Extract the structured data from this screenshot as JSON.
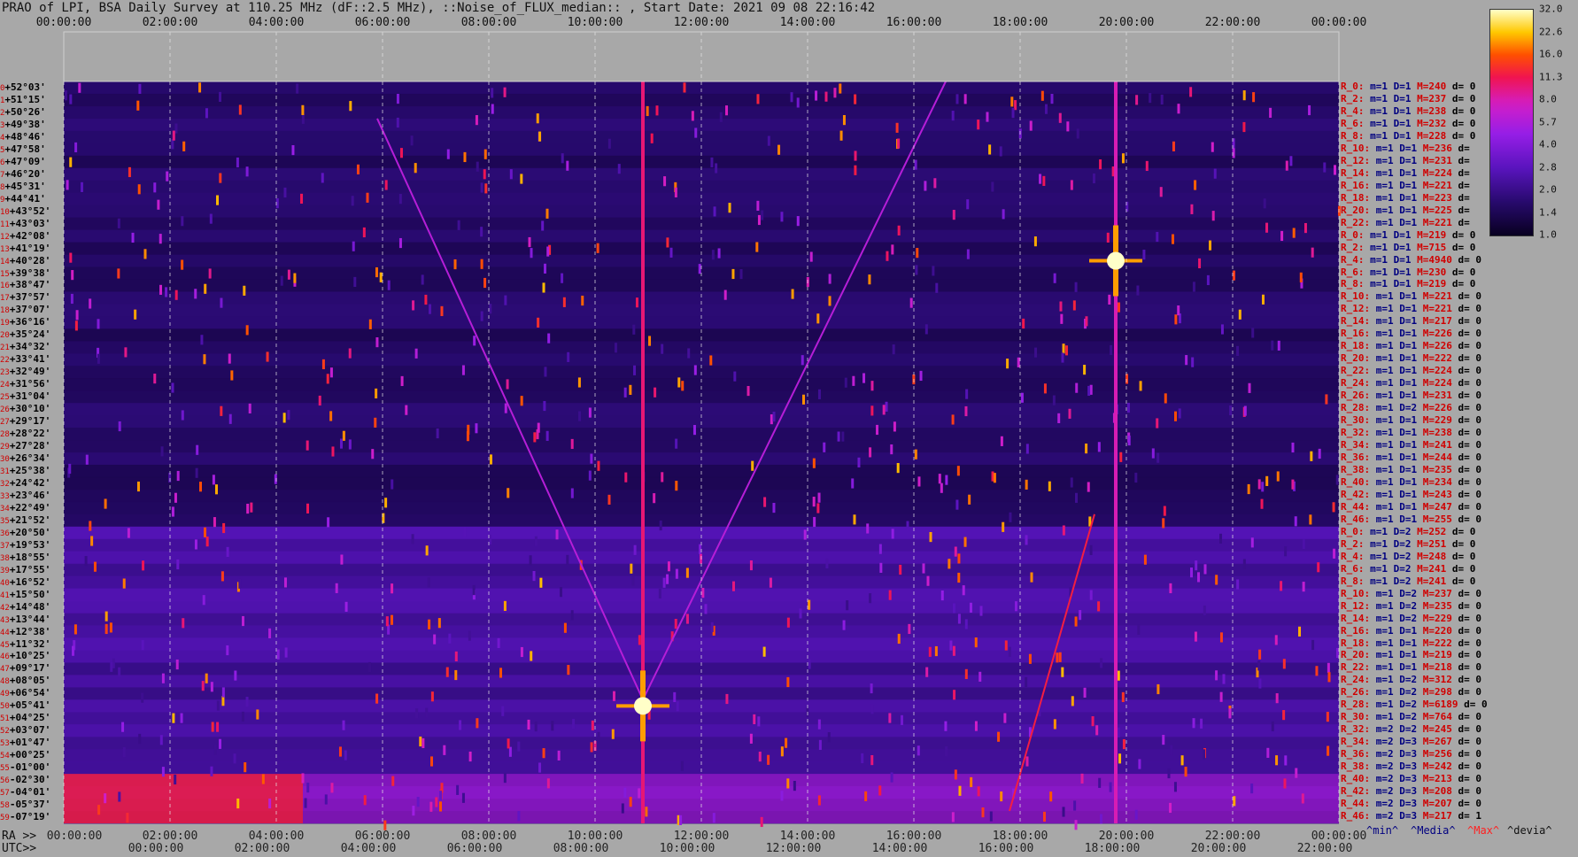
{
  "title": "PRAO of LPI, BSA Daily Survey at 110.25 MHz (dF::2.5 MHz), ::Noise_of_FLUX_median:: , Start Date: 2021 09 08 22:16:42",
  "top_axis": {
    "ticks": [
      "00:00:00",
      "02:00:00",
      "04:00:00",
      "06:00:00",
      "08:00:00",
      "10:00:00",
      "12:00:00",
      "14:00:00",
      "16:00:00",
      "18:00:00",
      "20:00:00",
      "22:00:00",
      "00:00:00"
    ]
  },
  "bottom_axis": {
    "ra_prefix": "RA >>",
    "ticks": [
      "00:00:00",
      "02:00:00",
      "04:00:00",
      "06:00:00",
      "08:00:00",
      "10:00:00",
      "12:00:00",
      "14:00:00",
      "16:00:00",
      "18:00:00",
      "20:00:00",
      "22:00:00",
      "00:00:00"
    ]
  },
  "utc_axis": {
    "prefix": "UTC>>",
    "ticks": [
      "00:00:00",
      "02:00:00",
      "04:00:00",
      "06:00:00",
      "08:00:00",
      "10:00:00",
      "12:00:00",
      "14:00:00",
      "16:00:00",
      "18:00:00",
      "20:00:00",
      "22:00:00"
    ]
  },
  "colorbar": {
    "labels": [
      "32.0",
      "22.6",
      "16.0",
      "11.3",
      "8.0",
      "5.7",
      "4.0",
      "2.8",
      "2.0",
      "1.4",
      "1.0"
    ]
  },
  "declination_labels": [
    {
      "i": "0",
      "dec": "+52°03'"
    },
    {
      "i": "1",
      "dec": "+51°15'"
    },
    {
      "i": "2",
      "dec": "+50°26'"
    },
    {
      "i": "3",
      "dec": "+49°38'"
    },
    {
      "i": "4",
      "dec": "+48°46'"
    },
    {
      "i": "5",
      "dec": "+47°58'"
    },
    {
      "i": "6",
      "dec": "+47°09'"
    },
    {
      "i": "7",
      "dec": "+46°20'"
    },
    {
      "i": "8",
      "dec": "+45°31'"
    },
    {
      "i": "9",
      "dec": "+44°41'"
    },
    {
      "i": "10",
      "dec": "+43°52'"
    },
    {
      "i": "11",
      "dec": "+43°03'"
    },
    {
      "i": "12",
      "dec": "+42°08'"
    },
    {
      "i": "13",
      "dec": "+41°19'"
    },
    {
      "i": "14",
      "dec": "+40°28'"
    },
    {
      "i": "15",
      "dec": "+39°38'"
    },
    {
      "i": "16",
      "dec": "+38°47'"
    },
    {
      "i": "17",
      "dec": "+37°57'"
    },
    {
      "i": "18",
      "dec": "+37°07'"
    },
    {
      "i": "19",
      "dec": "+36°16'"
    },
    {
      "i": "20",
      "dec": "+35°24'"
    },
    {
      "i": "21",
      "dec": "+34°32'"
    },
    {
      "i": "22",
      "dec": "+33°41'"
    },
    {
      "i": "23",
      "dec": "+32°49'"
    },
    {
      "i": "24",
      "dec": "+31°56'"
    },
    {
      "i": "25",
      "dec": "+31°04'"
    },
    {
      "i": "26",
      "dec": "+30°10'"
    },
    {
      "i": "27",
      "dec": "+29°17'"
    },
    {
      "i": "28",
      "dec": "+28°22'"
    },
    {
      "i": "29",
      "dec": "+27°28'"
    },
    {
      "i": "30",
      "dec": "+26°34'"
    },
    {
      "i": "31",
      "dec": "+25°38'"
    },
    {
      "i": "32",
      "dec": "+24°42'"
    },
    {
      "i": "33",
      "dec": "+23°46'"
    },
    {
      "i": "34",
      "dec": "+22°49'"
    },
    {
      "i": "35",
      "dec": "+21°52'"
    },
    {
      "i": "36",
      "dec": "+20°50'"
    },
    {
      "i": "37",
      "dec": "+19°53'"
    },
    {
      "i": "38",
      "dec": "+18°55'"
    },
    {
      "i": "39",
      "dec": "+17°55'"
    },
    {
      "i": "40",
      "dec": "+16°52'"
    },
    {
      "i": "41",
      "dec": "+15°50'"
    },
    {
      "i": "42",
      "dec": "+14°48'"
    },
    {
      "i": "43",
      "dec": "+13°44'"
    },
    {
      "i": "44",
      "dec": "+12°38'"
    },
    {
      "i": "45",
      "dec": "+11°32'"
    },
    {
      "i": "46",
      "dec": "+10°25'"
    },
    {
      "i": "47",
      "dec": "+09°17'"
    },
    {
      "i": "48",
      "dec": "+08°05'"
    },
    {
      "i": "49",
      "dec": "+06°54'"
    },
    {
      "i": "50",
      "dec": "+05°41'"
    },
    {
      "i": "51",
      "dec": "+04°25'"
    },
    {
      "i": "52",
      "dec": "+03°07'"
    },
    {
      "i": "53",
      "dec": "+01°47'"
    },
    {
      "i": "54",
      "dec": "+00°25'"
    },
    {
      "i": "55",
      "dec": "-01°00'"
    },
    {
      "i": "56",
      "dec": "-02°30'"
    },
    {
      "i": "57",
      "dec": "-04°01'"
    },
    {
      "i": "58",
      "dec": "-05°37'"
    },
    {
      "i": "59",
      "dec": "-07°19'"
    }
  ],
  "param_rows": [
    {
      "r": "R_0:",
      "m": "m=1",
      "D": "D=1",
      "M": "M=240",
      "d": "d= 0"
    },
    {
      "r": "R_2:",
      "m": "m=1",
      "D": "D=1",
      "M": "M=237",
      "d": "d= 0"
    },
    {
      "r": "R_4:",
      "m": "m=1",
      "D": "D=1",
      "M": "M=238",
      "d": "d= 0"
    },
    {
      "r": "R_6:",
      "m": "m=1",
      "D": "D=1",
      "M": "M=232",
      "d": "d= 0"
    },
    {
      "r": "R_8:",
      "m": "m=1",
      "D": "D=1",
      "M": "M=228",
      "d": "d= 0"
    },
    {
      "r": "R_10:",
      "m": "m=1",
      "D": "D=1",
      "M": "M=236",
      "d": "d="
    },
    {
      "r": "R_12:",
      "m": "m=1",
      "D": "D=1",
      "M": "M=231",
      "d": "d="
    },
    {
      "r": "R_14:",
      "m": "m=1",
      "D": "D=1",
      "M": "M=224",
      "d": "d="
    },
    {
      "r": "R_16:",
      "m": "m=1",
      "D": "D=1",
      "M": "M=221",
      "d": "d="
    },
    {
      "r": "R_18:",
      "m": "m=1",
      "D": "D=1",
      "M": "M=223",
      "d": "d="
    },
    {
      "r": "R_20:",
      "m": "m=1",
      "D": "D=1",
      "M": "M=225",
      "d": "d="
    },
    {
      "r": "R_22:",
      "m": "m=1",
      "D": "D=1",
      "M": "M=221",
      "d": "d="
    },
    {
      "r": "R_0:",
      "m": "m=1",
      "D": "D=1",
      "M": "M=219",
      "d": "d= 0"
    },
    {
      "r": "R_2:",
      "m": "m=1",
      "D": "D=1",
      "M": "M=715",
      "d": "d= 0"
    },
    {
      "r": "R_4:",
      "m": "m=1",
      "D": "D=1",
      "M": "M=4940",
      "d": "d= 0"
    },
    {
      "r": "R_6:",
      "m": "m=1",
      "D": "D=1",
      "M": "M=230",
      "d": "d= 0"
    },
    {
      "r": "R_8:",
      "m": "m=1",
      "D": "D=1",
      "M": "M=219",
      "d": "d= 0"
    },
    {
      "r": "R_10:",
      "m": "m=1",
      "D": "D=1",
      "M": "M=221",
      "d": "d= 0"
    },
    {
      "r": "R_12:",
      "m": "m=1",
      "D": "D=1",
      "M": "M=221",
      "d": "d= 0"
    },
    {
      "r": "R_14:",
      "m": "m=1",
      "D": "D=1",
      "M": "M=217",
      "d": "d= 0"
    },
    {
      "r": "R_16:",
      "m": "m=1",
      "D": "D=1",
      "M": "M=226",
      "d": "d= 0"
    },
    {
      "r": "R_18:",
      "m": "m=1",
      "D": "D=1",
      "M": "M=226",
      "d": "d= 0"
    },
    {
      "r": "R_20:",
      "m": "m=1",
      "D": "D=1",
      "M": "M=222",
      "d": "d= 0"
    },
    {
      "r": "R_22:",
      "m": "m=1",
      "D": "D=1",
      "M": "M=224",
      "d": "d= 0"
    },
    {
      "r": "R_24:",
      "m": "m=1",
      "D": "D=1",
      "M": "M=224",
      "d": "d= 0"
    },
    {
      "r": "R_26:",
      "m": "m=1",
      "D": "D=1",
      "M": "M=231",
      "d": "d= 0"
    },
    {
      "r": "R_28:",
      "m": "m=1",
      "D": "D=2",
      "M": "M=226",
      "d": "d= 0"
    },
    {
      "r": "R_30:",
      "m": "m=1",
      "D": "D=1",
      "M": "M=229",
      "d": "d= 0"
    },
    {
      "r": "R_32:",
      "m": "m=1",
      "D": "D=1",
      "M": "M=238",
      "d": "d= 0"
    },
    {
      "r": "R_34:",
      "m": "m=1",
      "D": "D=1",
      "M": "M=241",
      "d": "d= 0"
    },
    {
      "r": "R_36:",
      "m": "m=1",
      "D": "D=1",
      "M": "M=244",
      "d": "d= 0"
    },
    {
      "r": "R_38:",
      "m": "m=1",
      "D": "D=1",
      "M": "M=235",
      "d": "d= 0"
    },
    {
      "r": "R_40:",
      "m": "m=1",
      "D": "D=1",
      "M": "M=234",
      "d": "d= 0"
    },
    {
      "r": "R_42:",
      "m": "m=1",
      "D": "D=1",
      "M": "M=243",
      "d": "d= 0"
    },
    {
      "r": "R_44:",
      "m": "m=1",
      "D": "D=1",
      "M": "M=247",
      "d": "d= 0"
    },
    {
      "r": "R_46:",
      "m": "m=1",
      "D": "D=1",
      "M": "M=255",
      "d": "d= 0"
    },
    {
      "r": "R_0:",
      "m": "m=1",
      "D": "D=2",
      "M": "M=252",
      "d": "d= 0"
    },
    {
      "r": "R_2:",
      "m": "m=1",
      "D": "D=2",
      "M": "M=251",
      "d": "d= 0"
    },
    {
      "r": "R_4:",
      "m": "m=1",
      "D": "D=2",
      "M": "M=248",
      "d": "d= 0"
    },
    {
      "r": "R_6:",
      "m": "m=1",
      "D": "D=2",
      "M": "M=241",
      "d": "d= 0"
    },
    {
      "r": "R_8:",
      "m": "m=1",
      "D": "D=2",
      "M": "M=241",
      "d": "d= 0"
    },
    {
      "r": "R_10:",
      "m": "m=1",
      "D": "D=2",
      "M": "M=237",
      "d": "d= 0"
    },
    {
      "r": "R_12:",
      "m": "m=1",
      "D": "D=2",
      "M": "M=235",
      "d": "d= 0"
    },
    {
      "r": "R_14:",
      "m": "m=1",
      "D": "D=2",
      "M": "M=229",
      "d": "d= 0"
    },
    {
      "r": "R_16:",
      "m": "m=1",
      "D": "D=1",
      "M": "M=220",
      "d": "d= 0"
    },
    {
      "r": "R_18:",
      "m": "m=1",
      "D": "D=1",
      "M": "M=222",
      "d": "d= 0"
    },
    {
      "r": "R_20:",
      "m": "m=1",
      "D": "D=1",
      "M": "M=219",
      "d": "d= 0"
    },
    {
      "r": "R_22:",
      "m": "m=1",
      "D": "D=1",
      "M": "M=218",
      "d": "d= 0"
    },
    {
      "r": "R_24:",
      "m": "m=1",
      "D": "D=2",
      "M": "M=312",
      "d": "d= 0"
    },
    {
      "r": "R_26:",
      "m": "m=1",
      "D": "D=2",
      "M": "M=298",
      "d": "d= 0"
    },
    {
      "r": "R_28:",
      "m": "m=1",
      "D": "D=2",
      "M": "M=6189",
      "d": "d= 0"
    },
    {
      "r": "R_30:",
      "m": "m=1",
      "D": "D=2",
      "M": "M=764",
      "d": "d= 0"
    },
    {
      "r": "R_32:",
      "m": "m=2",
      "D": "D=2",
      "M": "M=245",
      "d": "d= 0"
    },
    {
      "r": "R_34:",
      "m": "m=2",
      "D": "D=3",
      "M": "M=267",
      "d": "d= 0"
    },
    {
      "r": "R_36:",
      "m": "m=2",
      "D": "D=3",
      "M": "M=256",
      "d": "d= 0"
    },
    {
      "r": "R_38:",
      "m": "m=2",
      "D": "D=3",
      "M": "M=242",
      "d": "d= 0"
    },
    {
      "r": "R_40:",
      "m": "m=2",
      "D": "D=3",
      "M": "M=213",
      "d": "d= 0"
    },
    {
      "r": "R_42:",
      "m": "m=2",
      "D": "D=3",
      "M": "M=208",
      "d": "d= 0"
    },
    {
      "r": "R_44:",
      "m": "m=2",
      "D": "D=3",
      "M": "M=207",
      "d": "d= 0"
    },
    {
      "r": "R_46:",
      "m": "m=2",
      "D": "D=3",
      "M": "M=217",
      "d": "d= 1"
    }
  ],
  "footer_legend": {
    "min": "^min^",
    "median": "^Media^",
    "max": "^Max^",
    "deviation": "^devia^"
  },
  "colors": {
    "background": "#a8a8a8",
    "plot_low": "#100030",
    "plot_mid": "#7a20c0",
    "plot_high": "#ff2000",
    "plot_peak": "#ffffa0",
    "label_red": "#d00000",
    "label_navy": "#000080"
  },
  "chart_data": {
    "type": "heatmap",
    "title": "PRAO of LPI, BSA Daily Survey at 110.25 MHz (dF::2.5 MHz), ::Noise_of_FLUX_median:: , Start Date: 2021 09 08 22:16:42",
    "xlabel": "RA / UTC",
    "ylabel": "",
    "x_range_hours": [
      0,
      24
    ],
    "rows": 60,
    "color_scale": "log",
    "color_range": [
      1.0,
      32.0
    ],
    "features": [
      {
        "kind": "vertical_track",
        "ra_hours": 10.9,
        "dec_rows": [
          0,
          59
        ],
        "intensity": 10
      },
      {
        "kind": "bright_source",
        "ra_hours": 10.9,
        "dec_row": 50,
        "intensity": 32
      },
      {
        "kind": "vertical_track",
        "ra_hours": 19.8,
        "dec_rows": [
          0,
          59
        ],
        "intensity": 8
      },
      {
        "kind": "bright_source",
        "ra_hours": 19.8,
        "dec_row": 14,
        "intensity": 32
      },
      {
        "kind": "diagonal_track",
        "from": [
          5.9,
          3
        ],
        "to": [
          10.9,
          50
        ],
        "intensity": 6
      },
      {
        "kind": "diagonal_track",
        "from": [
          16.6,
          0
        ],
        "to": [
          10.9,
          50
        ],
        "intensity": 6
      },
      {
        "kind": "diagonal_track",
        "from": [
          17.8,
          59
        ],
        "to": [
          19.4,
          35
        ],
        "intensity": 12
      },
      {
        "kind": "band",
        "dec_rows": [
          56,
          59
        ],
        "ra_hours": [
          0,
          4.5
        ],
        "intensity": 12
      }
    ]
  }
}
